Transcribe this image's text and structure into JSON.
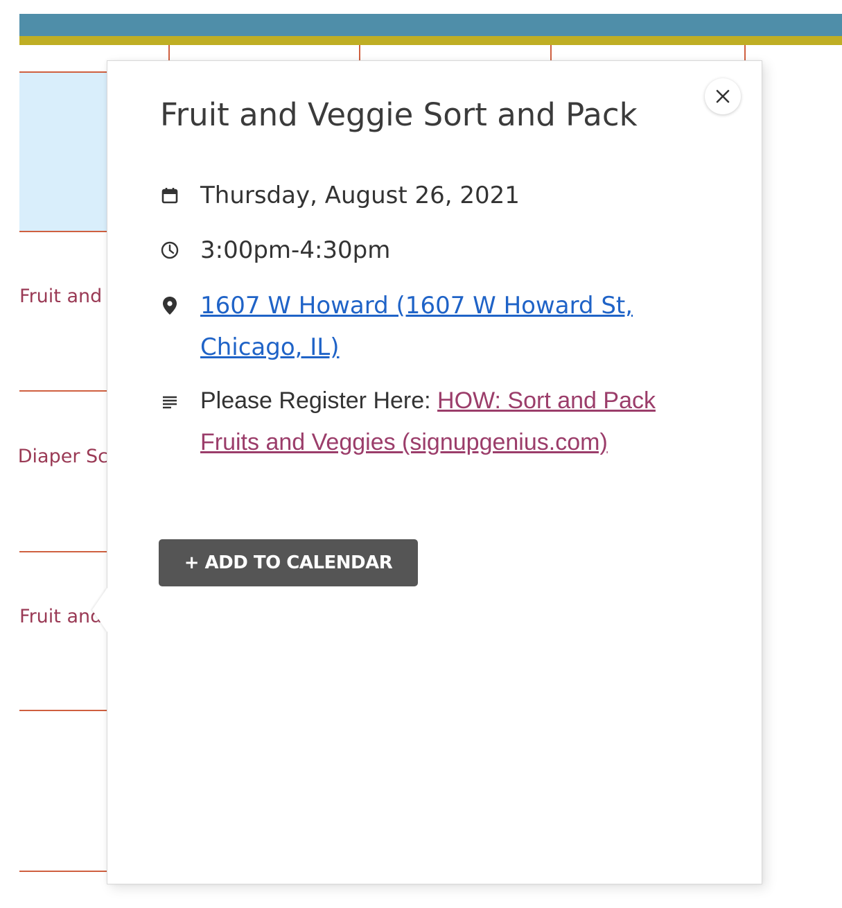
{
  "background": {
    "cells": [
      {
        "text": "Fruit and"
      },
      {
        "text": "Diaper Sc"
      },
      {
        "text": "Fruit and"
      }
    ],
    "colors": {
      "header_blue": "#4f8ea9",
      "header_gold": "#bfae24",
      "grid_line": "#cf5f3f",
      "highlight": "#d9eefb",
      "event_text": "#9a3a55"
    }
  },
  "popover": {
    "title": "Fruit and Veggie Sort and Pack",
    "close_icon": "close-icon",
    "date": {
      "icon": "calendar-icon",
      "text": "Thursday, August 26, 2021"
    },
    "time": {
      "icon": "clock-icon",
      "text": "3:00pm-4:30pm"
    },
    "location": {
      "icon": "map-pin-icon",
      "link_text": "1607 W Howard (1607 W Howard St, Chicago, IL)"
    },
    "description": {
      "icon": "notes-icon",
      "prefix": "Please Register Here: ",
      "link_text": "HOW: Sort and Pack Fruits and Veggies (signupgenius.com)"
    },
    "add_button_label": "+ ADD TO CALENDAR"
  }
}
